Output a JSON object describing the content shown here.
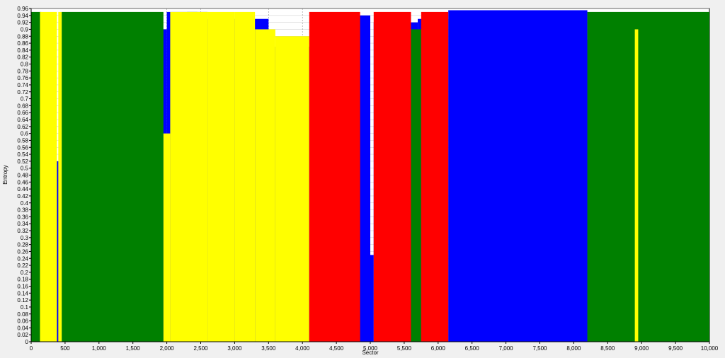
{
  "chart_data": {
    "type": "area",
    "xlabel": "Sector",
    "ylabel": "Entropy",
    "xlim": [
      0,
      10000
    ],
    "ylim": [
      0,
      0.96
    ],
    "x_ticks": [
      0,
      500,
      1000,
      1500,
      2000,
      2500,
      3000,
      3500,
      4000,
      4500,
      5000,
      5500,
      6000,
      6500,
      7000,
      7500,
      8000,
      8500,
      9000,
      9500,
      10000
    ],
    "x_tick_labels": [
      "0",
      "500",
      "1,000",
      "1,500",
      "2,000",
      "2,500",
      "3,000",
      "3,500",
      "4,000",
      "4,500",
      "5,000",
      "5,500",
      "6,000",
      "6,500",
      "7,000",
      "7,500",
      "8,000",
      "8,500",
      "9,000",
      "9,500",
      "10,000"
    ],
    "y_ticks": [
      0,
      0.02,
      0.04,
      0.06,
      0.08,
      0.1,
      0.12,
      0.14,
      0.16,
      0.18,
      0.2,
      0.22,
      0.24,
      0.26,
      0.28,
      0.3,
      0.32,
      0.34,
      0.36,
      0.38,
      0.4,
      0.42,
      0.44,
      0.46,
      0.48,
      0.5,
      0.52,
      0.54,
      0.56,
      0.58,
      0.6,
      0.62,
      0.64,
      0.66,
      0.68,
      0.7,
      0.72,
      0.74,
      0.76,
      0.78,
      0.8,
      0.82,
      0.84,
      0.86,
      0.88,
      0.9,
      0.92,
      0.94,
      0.96
    ],
    "y_tick_labels": [
      "0",
      "0.02",
      "0.04",
      "0.06",
      "0.08",
      "0.1",
      "0.12",
      "0.14",
      "0.16",
      "0.18",
      "0.2",
      "0.22",
      "0.24",
      "0.26",
      "0.28",
      "0.3",
      "0.32",
      "0.34",
      "0.36",
      "0.38",
      "0.4",
      "0.42",
      "0.44",
      "0.46",
      "0.48",
      "0.5",
      "0.52",
      "0.54",
      "0.56",
      "0.58",
      "0.6",
      "0.62",
      "0.64",
      "0.66",
      "0.68",
      "0.7",
      "0.72",
      "0.74",
      "0.76",
      "0.78",
      "0.8",
      "0.82",
      "0.84",
      "0.86",
      "0.88",
      "0.9",
      "0.92",
      "0.94",
      "0.96"
    ],
    "grid": true,
    "dashed_vertical_gridlines_x": [
      2000,
      2500,
      3500,
      4000
    ],
    "colors": {
      "blue": "#0000ff",
      "green": "#008000",
      "yellow": "#ffff00",
      "red": "#ff0000",
      "plot_background": "#ffffff",
      "grid": "#c8c8c8"
    },
    "series": [
      {
        "color": "blue",
        "segments": [
          {
            "x0": 0,
            "x1": 200,
            "y": 0.6
          },
          {
            "x0": 200,
            "x1": 420,
            "y": 0.52
          },
          {
            "x0": 420,
            "x1": 460,
            "y": 0.0
          },
          {
            "x0": 460,
            "x1": 1450,
            "y": 0.9
          },
          {
            "x0": 1450,
            "x1": 1900,
            "y": 0.93
          },
          {
            "x0": 1900,
            "x1": 2000,
            "y": 0.9
          },
          {
            "x0": 2000,
            "x1": 2600,
            "y": 0.95
          },
          {
            "x0": 2600,
            "x1": 3500,
            "y": 0.93
          },
          {
            "x0": 3500,
            "x1": 4150,
            "y": 0.85
          },
          {
            "x0": 4150,
            "x1": 4650,
            "y": 0.9
          },
          {
            "x0": 4650,
            "x1": 5000,
            "y": 0.94
          },
          {
            "x0": 5000,
            "x1": 5050,
            "y": 0.25
          },
          {
            "x0": 5050,
            "x1": 5700,
            "y": 0.92
          },
          {
            "x0": 5700,
            "x1": 6150,
            "y": 0.93
          },
          {
            "x0": 6150,
            "x1": 8200,
            "y": 0.955
          },
          {
            "x0": 8200,
            "x1": 10000,
            "y": 0.87
          }
        ]
      },
      {
        "color": "green",
        "segments": [
          {
            "x0": 0,
            "x1": 150,
            "y": 0.95
          },
          {
            "x0": 450,
            "x1": 1950,
            "y": 0.95
          },
          {
            "x0": 2300,
            "x1": 2450,
            "y": 0.95
          },
          {
            "x0": 4150,
            "x1": 4250,
            "y": 0.65
          },
          {
            "x0": 5600,
            "x1": 5750,
            "y": 0.9
          },
          {
            "x0": 8200,
            "x1": 10000,
            "y": 0.95
          }
        ]
      },
      {
        "color": "yellow",
        "segments": [
          {
            "x0": 130,
            "x1": 380,
            "y": 0.95
          },
          {
            "x0": 400,
            "x1": 450,
            "y": 0.95
          },
          {
            "x0": 1950,
            "x1": 2050,
            "y": 0.6
          },
          {
            "x0": 2050,
            "x1": 2600,
            "y": 0.95
          },
          {
            "x0": 2600,
            "x1": 3000,
            "y": 0.95
          },
          {
            "x0": 3000,
            "x1": 3300,
            "y": 0.95
          },
          {
            "x0": 3300,
            "x1": 3600,
            "y": 0.9
          },
          {
            "x0": 3600,
            "x1": 4100,
            "y": 0.88
          },
          {
            "x0": 4200,
            "x1": 4450,
            "y": 0.9
          },
          {
            "x0": 8900,
            "x1": 8950,
            "y": 0.9
          }
        ]
      },
      {
        "color": "red",
        "segments": [
          {
            "x0": 4100,
            "x1": 4850,
            "y": 0.95
          },
          {
            "x0": 5050,
            "x1": 5600,
            "y": 0.95
          },
          {
            "x0": 5750,
            "x1": 6150,
            "y": 0.95
          }
        ]
      }
    ]
  }
}
